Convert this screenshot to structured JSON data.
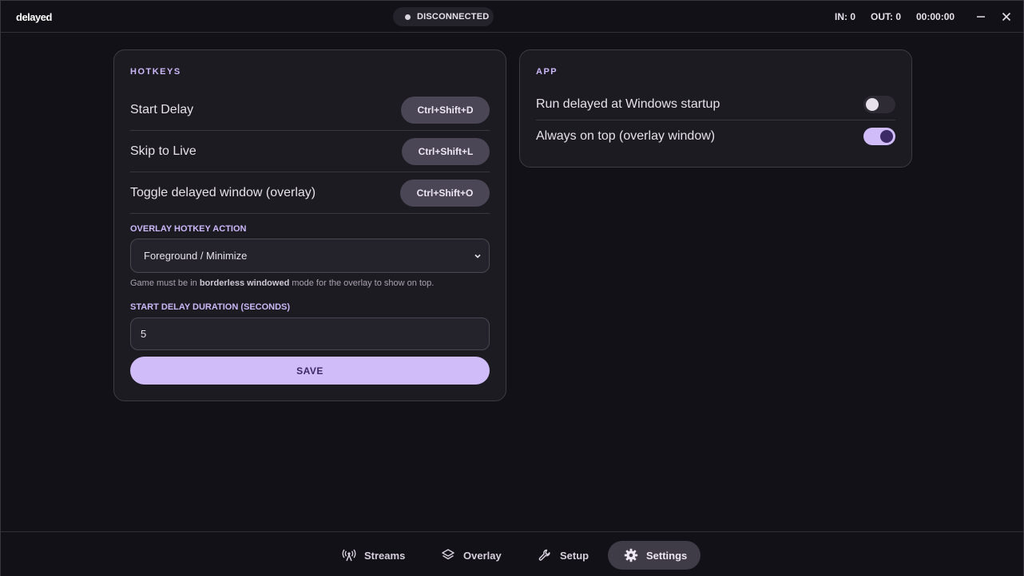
{
  "titlebar": {
    "logo": "delayed",
    "status": "DISCONNECTED",
    "in_label": "IN: 0",
    "out_label": "OUT: 0",
    "timer": "00:00:00"
  },
  "hotkeys": {
    "title": "HOTKEYS",
    "items": [
      {
        "label": "Start Delay",
        "key": "Ctrl+Shift+D"
      },
      {
        "label": "Skip to Live",
        "key": "Ctrl+Shift+L"
      },
      {
        "label": "Toggle delayed window (overlay)",
        "key": "Ctrl+Shift+O"
      }
    ],
    "overlay_action_label": "OVERLAY HOTKEY ACTION",
    "overlay_action_value": "Foreground / Minimize",
    "hint_prefix": "Game must be in ",
    "hint_bold": "borderless windowed",
    "hint_suffix": " mode for the overlay to show on top.",
    "duration_label": "START DELAY DURATION (SECONDS)",
    "duration_value": "5",
    "save_label": "SAVE"
  },
  "app": {
    "title": "APP",
    "options": [
      {
        "label": "Run delayed at Windows startup",
        "enabled": false
      },
      {
        "label": "Always on top (overlay window)",
        "enabled": true
      }
    ]
  },
  "nav": {
    "items": [
      {
        "label": "Streams",
        "icon": "antenna-icon",
        "active": false
      },
      {
        "label": "Overlay",
        "icon": "layers-icon",
        "active": false
      },
      {
        "label": "Setup",
        "icon": "wrench-icon",
        "active": false
      },
      {
        "label": "Settings",
        "icon": "gear-icon",
        "active": true
      }
    ]
  },
  "colors": {
    "accent": "#cfbcf9",
    "background": "#131118",
    "card": "#1d1b22"
  }
}
